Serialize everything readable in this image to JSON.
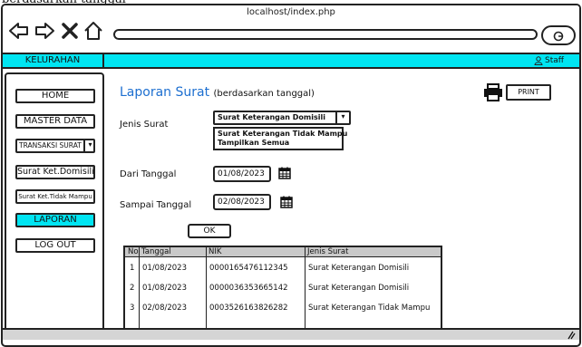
{
  "caption": "berdasarkan tanggal",
  "browser": {
    "tab_title": "localhost/index.php",
    "url": ""
  },
  "appbar": {
    "brand": "KELURAHAN",
    "user_label": "Staff",
    "accent": "#00e5f2"
  },
  "sidebar": {
    "items": [
      {
        "label": "HOME"
      },
      {
        "label": "MASTER DATA"
      },
      {
        "label": "TRANSAKSI SURAT"
      },
      {
        "label": "Surat Ket.Domisili"
      },
      {
        "label": "Surat Ket.Tidak Mampu"
      },
      {
        "label": "LAPORAN"
      },
      {
        "label": "LOG OUT"
      }
    ]
  },
  "main": {
    "title": "Laporan Surat",
    "subtitle": "(berdasarkan tanggal)",
    "print_label": "PRINT",
    "jenis_label": "Jenis Surat",
    "jenis_selected": "Surat Keterangan Domisili",
    "jenis_options": [
      "Surat Keterangan Tidak Mampu",
      "Tampilkan Semua"
    ],
    "dari_label": "Dari Tanggal",
    "dari_value": "01/08/2023",
    "sampai_label": "Sampai Tanggal",
    "sampai_value": "02/08/2023",
    "ok_label": "OK"
  },
  "table": {
    "columns": [
      "No",
      "Tanggal",
      "NIK",
      "Jenis Surat"
    ],
    "rows": [
      [
        "1",
        "01/08/2023",
        "0000165476112345",
        "Surat Keterangan Domisili"
      ],
      [
        "2",
        "01/08/2023",
        "0000036353665142",
        "Surat Keterangan Domisili"
      ],
      [
        "3",
        "02/08/2023",
        "0003526163826282",
        "Surat Keterangan Tidak Mampu"
      ]
    ]
  }
}
